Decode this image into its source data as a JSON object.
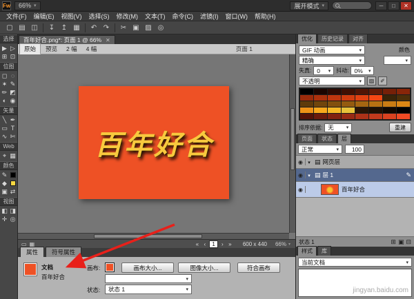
{
  "titlebar": {
    "app_initials": "Fw",
    "zoom": "66%",
    "mode_button": "展开模式",
    "minimize": "─",
    "maximize": "□",
    "close": "✕"
  },
  "menubar": {
    "items": [
      "文件(F)",
      "编辑(E)",
      "视图(V)",
      "选择(S)",
      "修改(M)",
      "文本(T)",
      "命令(C)",
      "滤镜(I)",
      "窗口(W)",
      "帮助(H)"
    ]
  },
  "toolbar": {
    "icons": [
      {
        "name": "new-document-icon",
        "glyph": "▢"
      },
      {
        "name": "open-icon",
        "glyph": "▤"
      },
      {
        "name": "save-icon",
        "glyph": "◫"
      },
      {
        "name": "import-icon",
        "glyph": "↧"
      },
      {
        "name": "export-icon",
        "glyph": "↥"
      },
      {
        "name": "print-icon",
        "glyph": "▦"
      },
      {
        "name": "undo-icon",
        "glyph": "↶"
      },
      {
        "name": "redo-icon",
        "glyph": "↷"
      },
      {
        "name": "cut-icon",
        "glyph": "✂"
      },
      {
        "name": "copy-icon",
        "glyph": "▣"
      },
      {
        "name": "paste-icon",
        "glyph": "▨"
      },
      {
        "name": "find-icon",
        "glyph": "◎"
      }
    ]
  },
  "tools": {
    "sections": [
      {
        "label": "选择",
        "tools": [
          {
            "name": "pointer-tool",
            "glyph": "▶"
          },
          {
            "name": "subselection-tool",
            "glyph": "▷"
          },
          {
            "name": "scale-tool",
            "glyph": "⊞"
          },
          {
            "name": "crop-tool",
            "glyph": "⊡"
          }
        ]
      },
      {
        "label": "位图",
        "tools": [
          {
            "name": "marquee-tool",
            "glyph": "◻"
          },
          {
            "name": "lasso-tool",
            "glyph": "◌"
          },
          {
            "name": "magic-wand-tool",
            "glyph": "✶"
          },
          {
            "name": "brush-tool",
            "glyph": "✎"
          },
          {
            "name": "pencil-tool",
            "glyph": "✏"
          },
          {
            "name": "eraser-tool",
            "glyph": "◩"
          },
          {
            "name": "blur-tool",
            "glyph": "◐"
          },
          {
            "name": "rubber-stamp-tool",
            "glyph": "◉"
          }
        ]
      },
      {
        "label": "矢量",
        "tools": [
          {
            "name": "line-tool",
            "glyph": "╲"
          },
          {
            "name": "pen-tool",
            "glyph": "✒"
          },
          {
            "name": "rectangle-tool",
            "glyph": "▭"
          },
          {
            "name": "text-tool",
            "glyph": "T"
          },
          {
            "name": "freeform-tool",
            "glyph": "∿"
          },
          {
            "name": "knife-tool",
            "glyph": "✄"
          }
        ]
      },
      {
        "label": "Web",
        "tools": [
          {
            "name": "hotspot-tool",
            "glyph": "⌖"
          },
          {
            "name": "slice-tool",
            "glyph": "▦"
          }
        ]
      },
      {
        "label": "颜色",
        "tools": [
          {
            "name": "stroke-color-tool",
            "glyph": "✎"
          },
          {
            "name": "stroke-color-chip",
            "chip": "#000000"
          },
          {
            "name": "fill-color-tool",
            "glyph": "◆"
          },
          {
            "name": "fill-color-chip",
            "chip": "#f5d742"
          },
          {
            "name": "default-colors-icon",
            "glyph": "▣"
          },
          {
            "name": "swap-colors-icon",
            "glyph": "⇄"
          }
        ]
      },
      {
        "label": "视图",
        "tools": [
          {
            "name": "standard-screen-mode-tool",
            "glyph": "◧"
          },
          {
            "name": "full-screen-mode-tool",
            "glyph": "◨"
          },
          {
            "name": "hand-tool",
            "glyph": "✛"
          },
          {
            "name": "zoom-tool",
            "glyph": "◎"
          }
        ]
      }
    ]
  },
  "doc_tab": {
    "title": "百年好合.png*: 页面 1 @ 66%",
    "close": "✕"
  },
  "view_bar": {
    "tabs": [
      "原始",
      "预览",
      "2 幅",
      "4 幅"
    ],
    "active_index": 0,
    "page_label": "页面 1"
  },
  "canvas": {
    "pasteboard_color": "#767676",
    "document_color": "#ee5125",
    "text": "百年好合",
    "text_color": "#f8c93e"
  },
  "canvas_status": {
    "nav": [
      "«",
      "‹",
      "1",
      "›",
      "»"
    ],
    "size": "600 x 440",
    "zoom": "66%"
  },
  "properties": {
    "tabs": [
      "属性",
      "符号属性"
    ],
    "doc_type": "文档",
    "doc_name": "百年好合",
    "canvas_label": "画布:",
    "canvas_color": "#ee5125",
    "canvas_size_button": "画布大小...",
    "image_size_button": "图像大小...",
    "fit_canvas_button": "符合画布",
    "state_label": "状态:",
    "state_value": "状态 1"
  },
  "optimize_panel": {
    "tabs": [
      "优化",
      "历史记录",
      "对齐"
    ],
    "format": "GIF 动画",
    "colors_label": "颜色",
    "palette": "精确",
    "loss_label": "失真:",
    "loss_value": "0",
    "dither_label": "抖动:",
    "dither_value": "0%",
    "transparency": "不透明",
    "sort_label": "排序依据:",
    "sort_value": "无",
    "rebuild_button": "重建",
    "swatches": [
      "#000000",
      "#1c0500",
      "#2e0a02",
      "#401003",
      "#521505",
      "#641b06",
      "#762008",
      "#882609",
      "#9a2b0b",
      "#ac310c",
      "#be360e",
      "#d03c0f",
      "#e24111",
      "#f44713",
      "#3a2408",
      "#4c2f09",
      "#5e3a0b",
      "#70450c",
      "#82500e",
      "#945b0f",
      "#a66611",
      "#b87112",
      "#ca7c14",
      "#dc8715",
      "#ee9217",
      "#f8a81c",
      "#f5b826",
      "#e8c23a",
      "#2a1505",
      "#1f1003",
      "#120800",
      "#000000",
      "#551208",
      "#6b1a0c",
      "#812210",
      "#972a14",
      "#ad3218",
      "#c33a1c",
      "#d94220",
      "#ef4a24"
    ]
  },
  "layers_panel": {
    "tabs": [
      "页面",
      "状态",
      "层"
    ],
    "blend_mode": "正常",
    "opacity": "100",
    "rows": [
      {
        "name": "网页层",
        "type": "web-layer"
      },
      {
        "name": "层 1",
        "type": "layer"
      },
      {
        "name": "百年好合",
        "type": "object",
        "thumb_color": "#ee5125"
      }
    ],
    "state_label": "状态 1"
  },
  "library_panel": {
    "tabs": [
      "样式",
      "库"
    ],
    "source": "当前文档"
  },
  "watermark": "jingyan.baidu.com",
  "annotation": {
    "arrow_color": "#e8201a"
  }
}
